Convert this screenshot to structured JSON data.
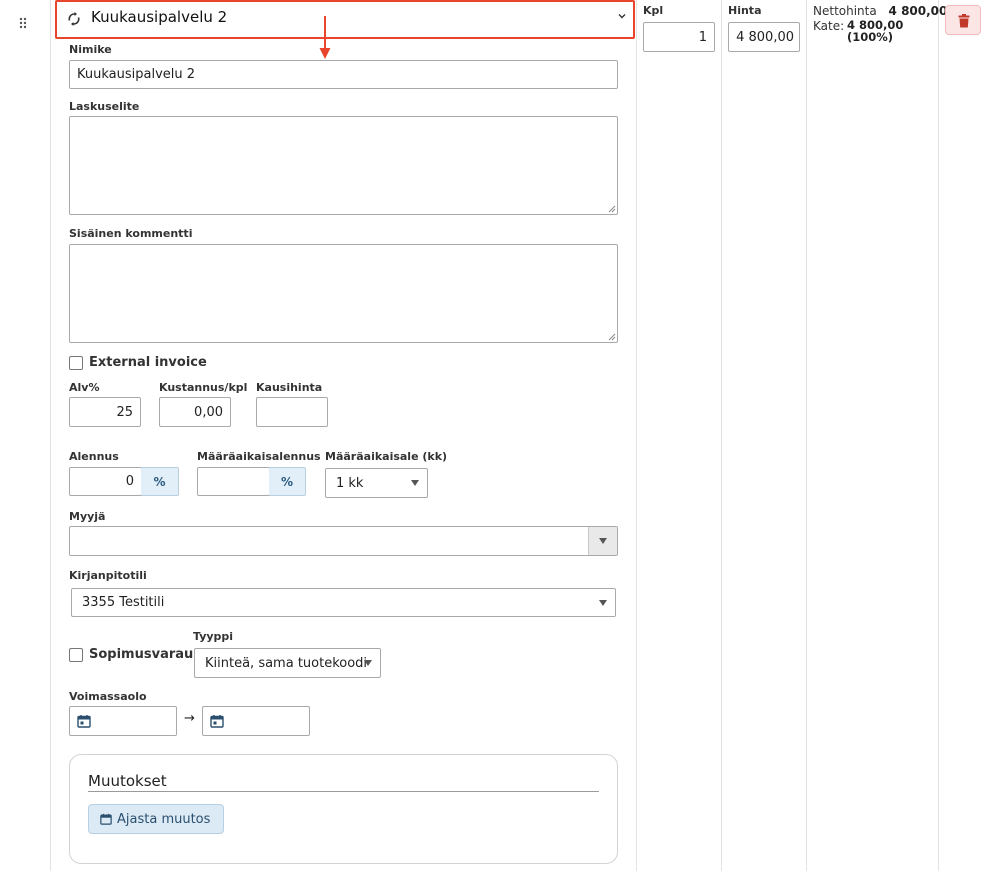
{
  "product": {
    "name": "Kuukausipalvelu 2"
  },
  "fields": {
    "nimike_label": "Nimike",
    "nimike_value": "Kuukausipalvelu 2",
    "laskuselite_label": "Laskuselite",
    "sisainen_label": "Sisäinen kommentti",
    "external_invoice_label": "External invoice",
    "alv_label": "Alv%",
    "alv_value": "25",
    "kustannus_label": "Kustannus/kpl",
    "kustannus_value": "0,00",
    "kausihinta_label": "Kausihinta",
    "kausihinta_value": "",
    "alennus_label": "Alennus",
    "alennus_value": "0",
    "alennus_unit": "%",
    "maaraaikaisalennus_label": "Määräaikaisalennus",
    "maaraaikaisalennus_value": "",
    "maaraaikaisalennus_unit": "%",
    "maaraaikaisale_label": "Määräaikaisale (kk)",
    "maaraaikaisale_value": "1 kk",
    "myyja_label": "Myyjä",
    "myyja_value": "",
    "kirjanpitotili_label": "Kirjanpitotili",
    "kirjanpitotili_value": "3355 Testitili",
    "sopimusvaraus_label": "Sopimusvaraus",
    "tyyppi_label": "Tyyppi",
    "tyyppi_value": "Kiinteä, sama tuotekoodi",
    "voimassaolo_label": "Voimassaolo",
    "voimassaolo_separator": "→"
  },
  "muutokset": {
    "title": "Muutokset",
    "button_label": "Ajasta muutos"
  },
  "columns": {
    "kpl_label": "Kpl",
    "kpl_value": "1",
    "hinta_label": "Hinta",
    "hinta_value": "4 800,00",
    "nettohinta_label": "Nettohinta",
    "nettohinta_value": "4 800,00",
    "kate_label": "Kate:",
    "kate_value": "4 800,00",
    "kate_percent": "(100%)"
  },
  "icons": {
    "drag": "drag-handle-icon",
    "recurring": "recurring-icon",
    "chevron": "chevron-down-icon",
    "calendar": "calendar-icon",
    "delete": "trash-icon"
  },
  "colors": {
    "highlight_border": "#e8452c",
    "delete_icon": "#c0392b",
    "addon_bg": "#e3eff8"
  }
}
